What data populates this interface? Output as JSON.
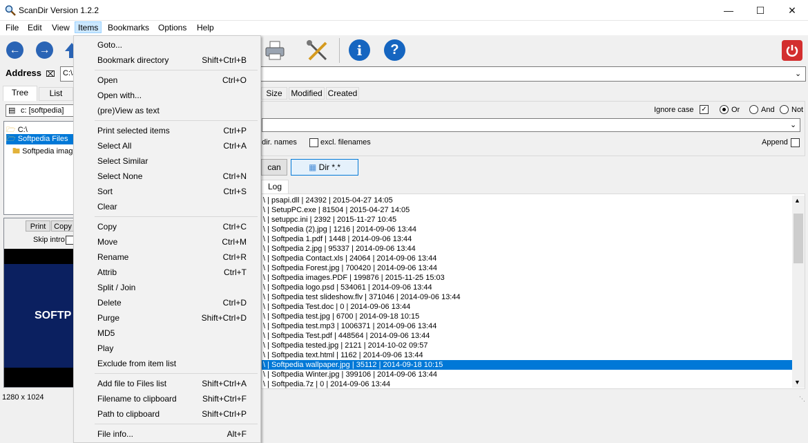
{
  "window": {
    "title": "ScanDir Version 1.2.2"
  },
  "menubar": {
    "items": [
      "File",
      "Edit",
      "View",
      "Items",
      "Bookmarks",
      "Options",
      "Help"
    ]
  },
  "address": {
    "label": "Address",
    "value": "C:\\S"
  },
  "left_tabs": [
    "Tree",
    "List"
  ],
  "drive": {
    "value": "c: [softpedia]"
  },
  "tree": [
    "C:\\",
    "Softpedia Files",
    "Softpedia imag"
  ],
  "preview": {
    "print": "Print",
    "copy": "Copy",
    "skip_intro": "Skip intro",
    "text": "SOFTP"
  },
  "status": {
    "dimensions": "1280 x 1024"
  },
  "columns": [
    "Size",
    "Modified",
    "Created"
  ],
  "filter": {
    "ignore_case": "Ignore case",
    "or": "Or",
    "and": "And",
    "not": "Not",
    "dir_names": ". dir. names",
    "excl_filenames": "excl. filenames",
    "append": "Append"
  },
  "buttons": {
    "scan": "can",
    "dir": "Dir *.*"
  },
  "log_tab": "Log",
  "results": [
    "\\ | psapi.dll | 24392 | 2015-04-27 14:05",
    "\\ | SetupPC.exe | 81504 | 2015-04-27 14:05",
    "\\ | setuppc.ini | 2392 | 2015-11-27 10:45",
    "\\ | Softpedia (2).jpg | 1216 | 2014-09-06 13:44",
    "\\ | Softpedia 1.pdf | 1448 | 2014-09-06 13:44",
    "\\ | Softpedia 2.jpg | 95337 | 2014-09-06 13:44",
    "\\ | Softpedia Contact.xls | 24064 | 2014-09-06 13:44",
    "\\ | Softpedia Forest.jpg | 700420 | 2014-09-06 13:44",
    "\\ | Softpedia images.PDF | 199876 | 2015-11-25 15:03",
    "\\ | Softpedia logo.psd | 534061 | 2014-09-06 13:44",
    "\\ | Softpedia test slideshow.flv | 371046 | 2014-09-06 13:44",
    "\\ | Softpedia Test.doc | 0 | 2014-09-06 13:44",
    "\\ | Softpedia test.jpg | 6700 | 2014-09-18 10:15",
    "\\ | Softpedia test.mp3 | 1006371 | 2014-09-06 13:44",
    "\\ | Softpedia Test.pdf | 448564 | 2014-09-06 13:44",
    "\\ | Softpedia tested.jpg | 2121 | 2014-10-02 09:57",
    "\\ | Softpedia text.html | 1162 | 2014-09-06 13:44",
    "\\ | Softpedia wallpaper.jpg | 35112 | 2014-09-18 10:15",
    "\\ | Softpedia Winter.jpg | 399106 | 2014-09-06 13:44",
    "\\ | Softpedia.7z | 0 | 2014-09-06 13:44"
  ],
  "selected_result": 17,
  "items_menu": [
    {
      "label": "Goto...",
      "shortcut": ""
    },
    {
      "label": "Bookmark directory",
      "shortcut": "Shift+Ctrl+B"
    },
    {
      "sep": true
    },
    {
      "label": "Open",
      "shortcut": "Ctrl+O"
    },
    {
      "label": "Open with...",
      "shortcut": ""
    },
    {
      "label": "(pre)View as text",
      "shortcut": ""
    },
    {
      "sep": true
    },
    {
      "label": "Print selected items",
      "shortcut": "Ctrl+P"
    },
    {
      "label": "Select All",
      "shortcut": "Ctrl+A"
    },
    {
      "label": "Select Similar",
      "shortcut": ""
    },
    {
      "label": "Select None",
      "shortcut": "Ctrl+N"
    },
    {
      "label": "Sort",
      "shortcut": "Ctrl+S"
    },
    {
      "label": "Clear",
      "shortcut": ""
    },
    {
      "sep": true
    },
    {
      "label": "Copy",
      "shortcut": "Ctrl+C"
    },
    {
      "label": "Move",
      "shortcut": "Ctrl+M"
    },
    {
      "label": "Rename",
      "shortcut": "Ctrl+R"
    },
    {
      "label": "Attrib",
      "shortcut": "Ctrl+T"
    },
    {
      "label": "Split / Join",
      "shortcut": ""
    },
    {
      "label": "Delete",
      "shortcut": "Ctrl+D"
    },
    {
      "label": "Purge",
      "shortcut": "Shift+Ctrl+D"
    },
    {
      "label": "MD5",
      "shortcut": ""
    },
    {
      "label": "Play",
      "shortcut": ""
    },
    {
      "label": "Exclude from item list",
      "shortcut": ""
    },
    {
      "sep": true
    },
    {
      "label": "Add file to Files list",
      "shortcut": "Shift+Ctrl+A"
    },
    {
      "label": "Filename to clipboard",
      "shortcut": "Shift+Ctrl+F"
    },
    {
      "label": "Path to clipboard",
      "shortcut": "Shift+Ctrl+P"
    },
    {
      "sep": true
    },
    {
      "label": "File info...",
      "shortcut": "Alt+F"
    }
  ],
  "colors": {
    "accent": "#0078d7",
    "menu_hover": "#cce8ff",
    "info_blue": "#1565c0",
    "power_red": "#d32f2f"
  }
}
